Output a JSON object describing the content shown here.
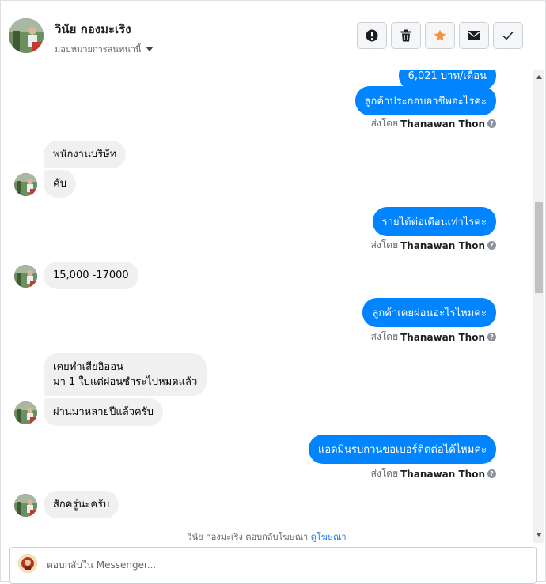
{
  "header": {
    "contact_name": "วินัย กองมะเริง",
    "assign_label": "มอบหมายการสนทนานี้",
    "tools": [
      {
        "name": "report-button",
        "icon": "alert-circle-icon"
      },
      {
        "name": "delete-button",
        "icon": "trash-icon"
      },
      {
        "name": "star-button",
        "icon": "star-icon",
        "color": "#f7923b"
      },
      {
        "name": "mark-unread-button",
        "icon": "envelope-icon"
      },
      {
        "name": "done-button",
        "icon": "check-icon"
      }
    ]
  },
  "messages": {
    "partial_top": "6,021 บาท/เดือน",
    "m1": "ลูกค้าประกอบอาชีพอะไรคะ",
    "m2": "พนักงานบริษัท",
    "m3": "คับ",
    "m4": "รายได้ต่อเดือนเท่าไรคะ",
    "m5": "15,000 -17000",
    "m6": "ลูกค้าเคยผ่อนอะไรไหมคะ",
    "m7_line1": "เคยทำเสียอิออน",
    "m7_line2": "มา 1 ใบแต่ผ่อนชำระไปหมดแล้ว",
    "m8": "ผ่านมาหลายปีแล้วครับ",
    "m9": "แอดมินรบกวนขอเบอร์ติดต่อได้ไหมคะ",
    "m10": "สักครู่นะครับ"
  },
  "sent_by": {
    "prefix": "ส่งโดย",
    "agent": "Thanawan Thon",
    "help": "?"
  },
  "footnote": {
    "text": "วินัย กองมะเริง ตอบกลับโฆษณา",
    "link": "ดูโฆษณา"
  },
  "composer": {
    "placeholder": "ตอบกลับใน Messenger..."
  },
  "colors": {
    "outgoing": "#0084ff",
    "incoming": "#f0f0f0",
    "link": "#1877f2"
  }
}
